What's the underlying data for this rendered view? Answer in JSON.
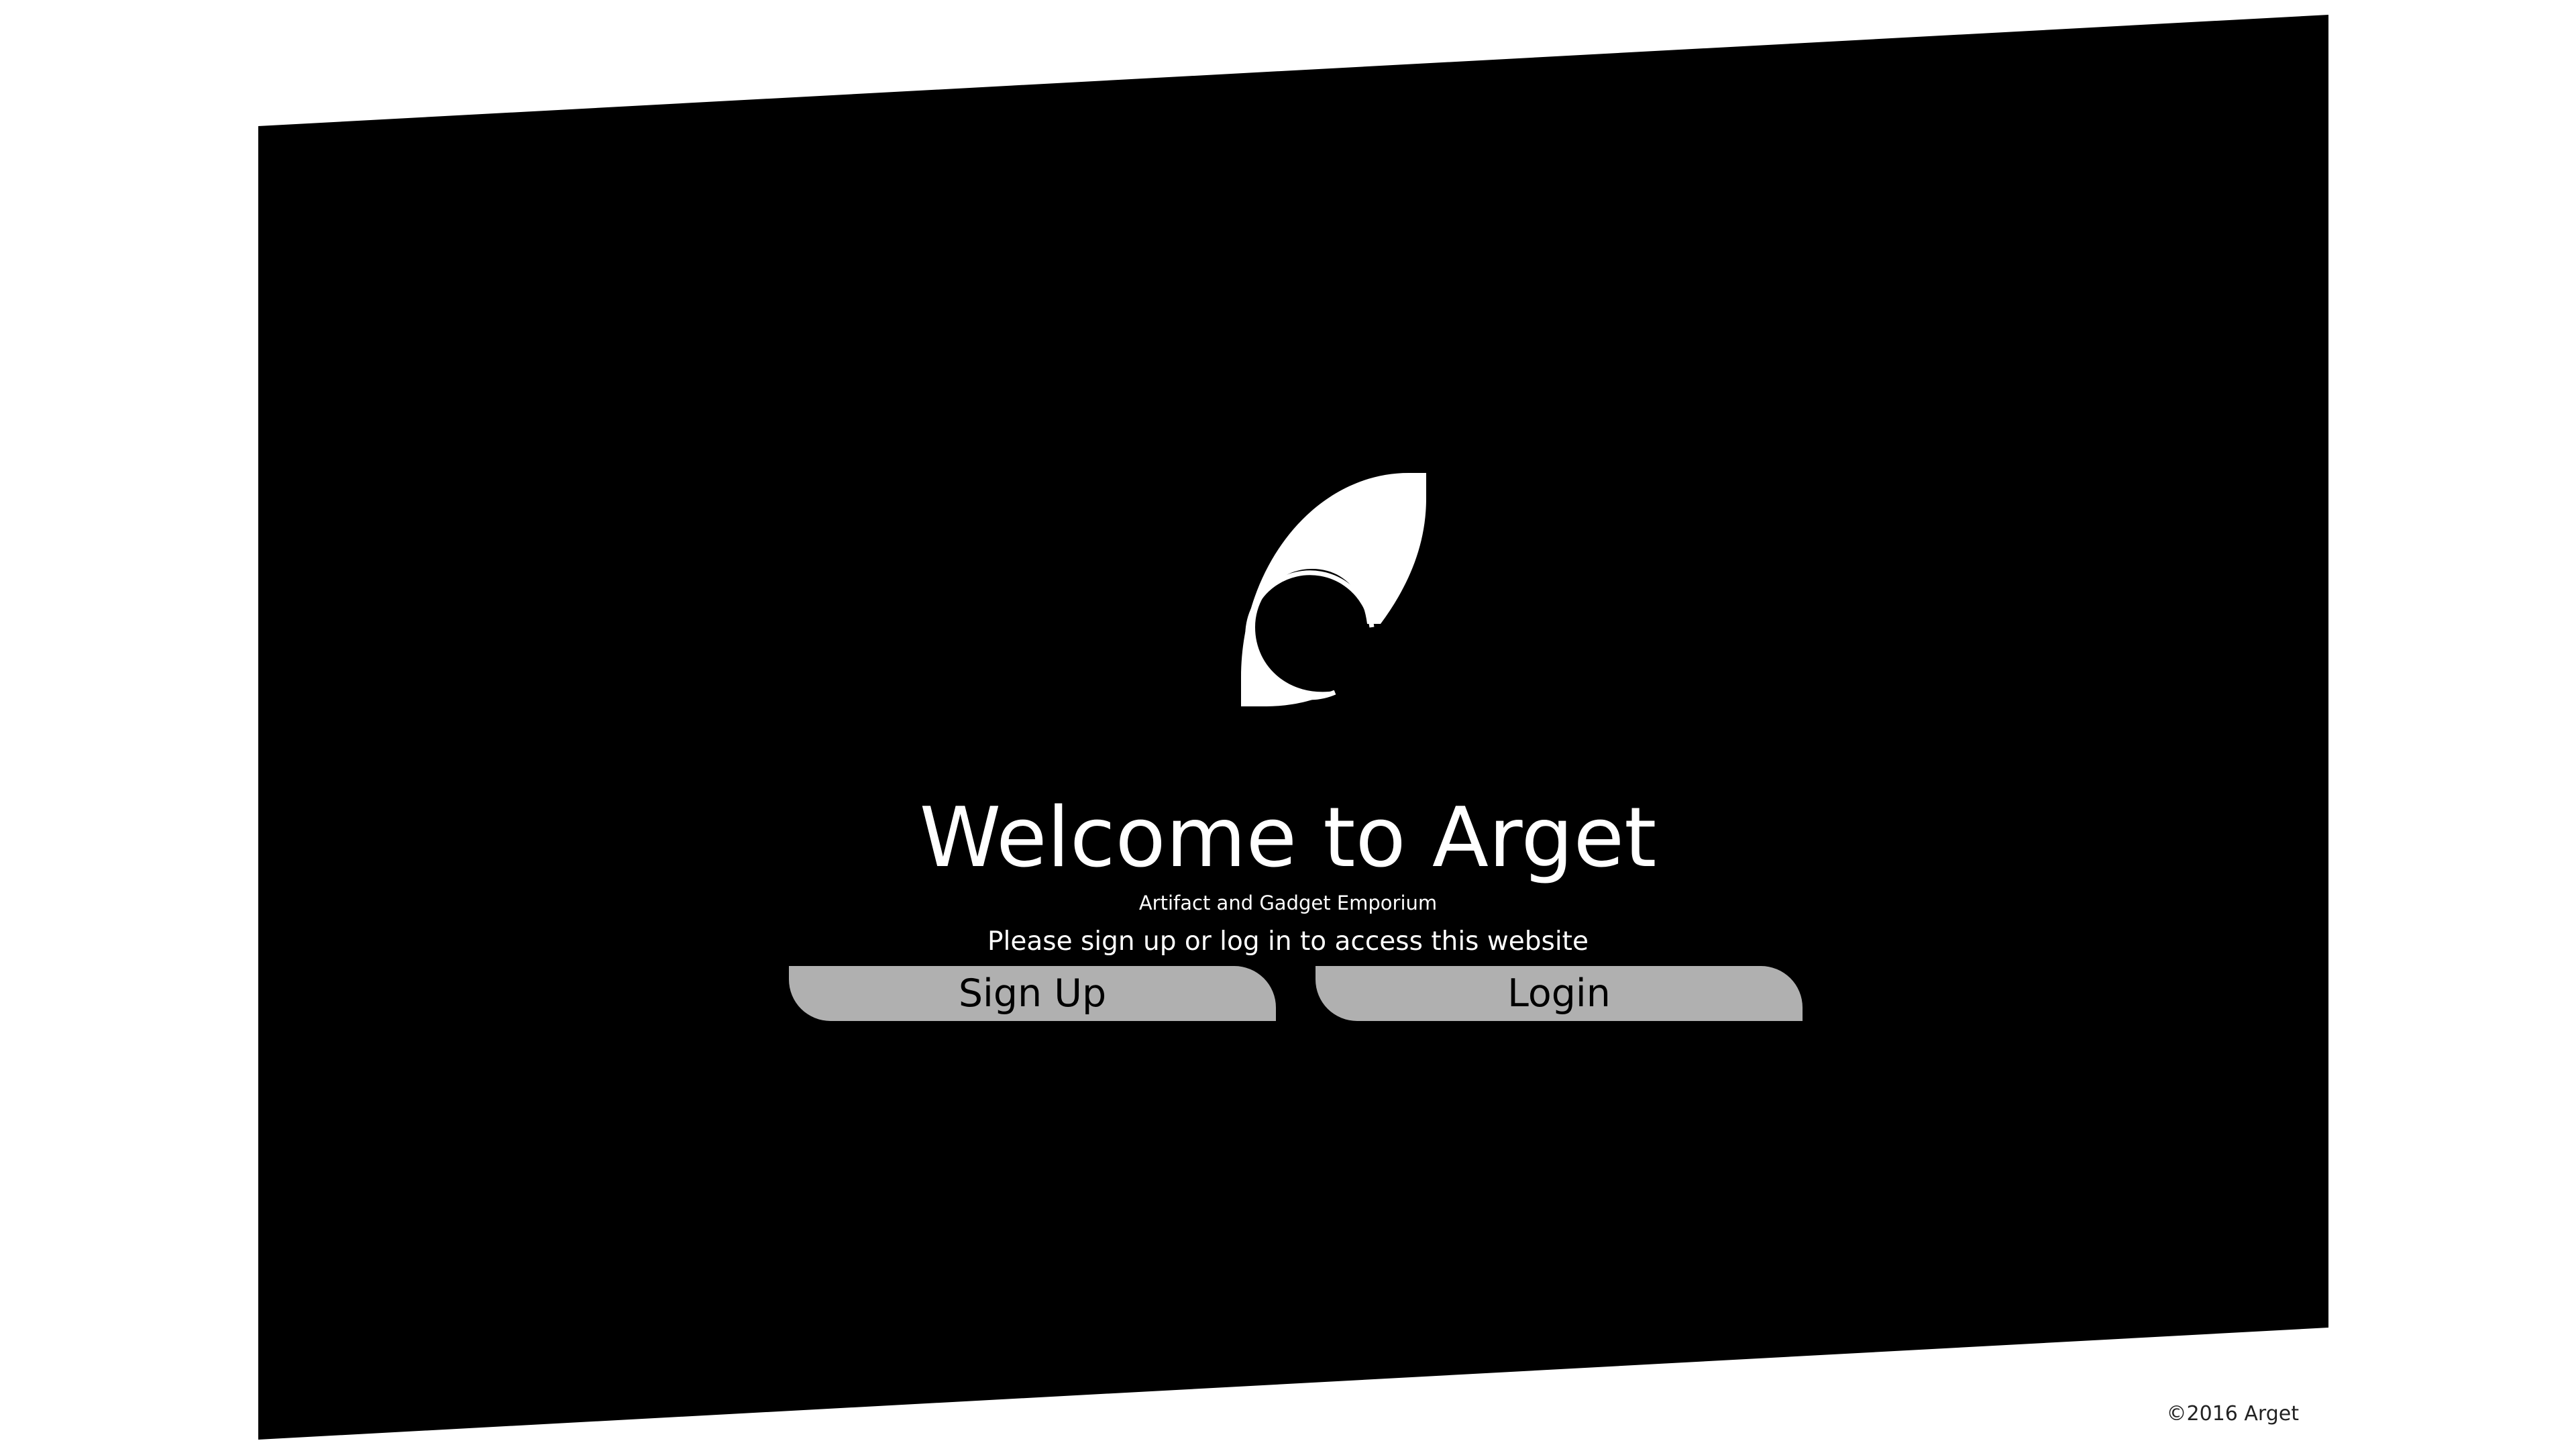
{
  "colors": {
    "page_background": "#ffffff",
    "panel": "#000000",
    "text": "#ffffff",
    "button": "#b0b0b0",
    "button_text": "#000000"
  },
  "logo": {
    "icon": "arget-logo-icon"
  },
  "hero": {
    "title": "Welcome to Arget",
    "subtitle": "Artifact and Gadget Emporium",
    "instructions": "Please sign up or log in to access this website"
  },
  "buttons": {
    "signup_label": "Sign Up",
    "login_label": "Login"
  },
  "footer": {
    "copyright": "©2016 Arget"
  }
}
